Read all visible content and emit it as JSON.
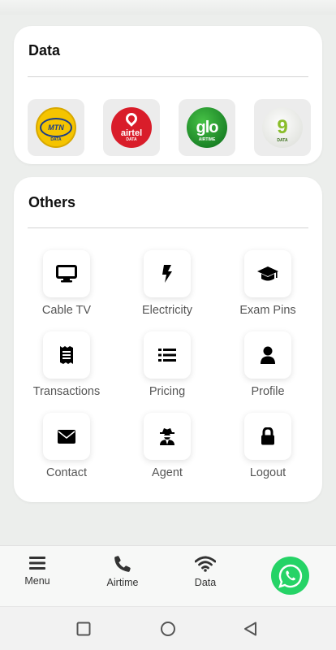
{
  "data_section": {
    "title": "Data",
    "networks": [
      {
        "name": "mtn-logo",
        "brand_text": "MTN",
        "tag": "DATA",
        "color": "#f5c400"
      },
      {
        "name": "airtel-logo",
        "brand_text": "airtel",
        "tag": "DATA",
        "color": "#d91d2a"
      },
      {
        "name": "glo-logo",
        "brand_text": "glo",
        "tag": "AIRTIME",
        "color": "#0a6b1a"
      },
      {
        "name": "9mobile-logo",
        "brand_text": "9",
        "tag": "DATA",
        "color": "#8abd2a"
      }
    ]
  },
  "others_section": {
    "title": "Others",
    "items": [
      {
        "label": "Cable TV",
        "icon": "tv-icon"
      },
      {
        "label": "Electricity",
        "icon": "bolt-icon"
      },
      {
        "label": "Exam Pins",
        "icon": "graduation-cap-icon"
      },
      {
        "label": "Transactions",
        "icon": "receipt-icon"
      },
      {
        "label": "Pricing",
        "icon": "list-icon"
      },
      {
        "label": "Profile",
        "icon": "user-icon"
      },
      {
        "label": "Contact",
        "icon": "envelope-icon"
      },
      {
        "label": "Agent",
        "icon": "agent-icon"
      },
      {
        "label": "Logout",
        "icon": "lock-icon"
      }
    ]
  },
  "bottom_nav": {
    "items": [
      {
        "label": "Menu",
        "icon": "menu-icon"
      },
      {
        "label": "Airtime",
        "icon": "phone-icon"
      },
      {
        "label": "Data",
        "icon": "wifi-icon"
      }
    ],
    "whatsapp": {
      "icon": "whatsapp-icon",
      "color": "#25d366"
    }
  },
  "system_nav": [
    "square-icon",
    "circle-icon",
    "back-triangle-icon"
  ]
}
